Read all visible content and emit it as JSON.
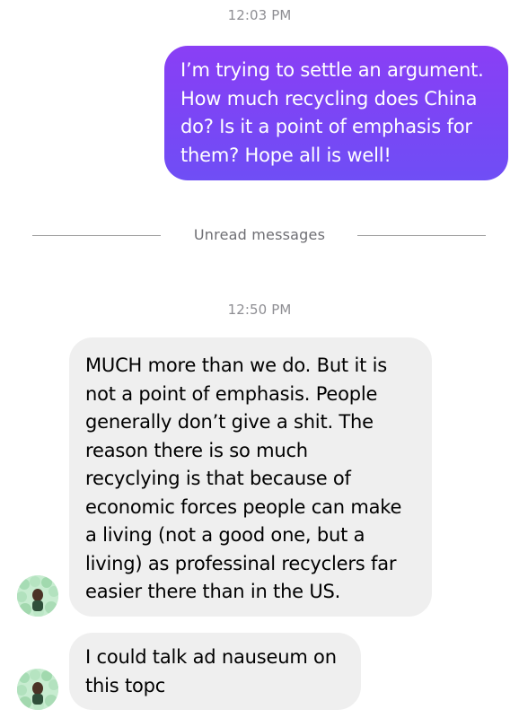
{
  "conversation": {
    "timestamp_1": "12:03 PM",
    "outgoing_message": "I’m trying to settle an argument.\nHow much recycling does China\ndo? Is it a point of emphasis for\nthem? Hope all is well!",
    "unread_divider": "Unread messages",
    "timestamp_2": "12:50 PM",
    "incoming_message_1": "MUCH more than we do. But it is\nnot a point of emphasis. People\ngenerally don’t give a shit. The\nreason there is so much\nrecyclying is that because of\neconomic forces people can make\na living (not a good one, but a\nliving) as professinal recyclers far\neasier there than in the US.",
    "incoming_message_2": "I could talk ad nauseum on\nthis topc"
  },
  "colors": {
    "outgoing_bubble": "#7a46f5",
    "incoming_bubble": "#efefef",
    "timestamp_text": "#8e8e93"
  },
  "icons": {
    "avatar": "contact-avatar-icon"
  }
}
